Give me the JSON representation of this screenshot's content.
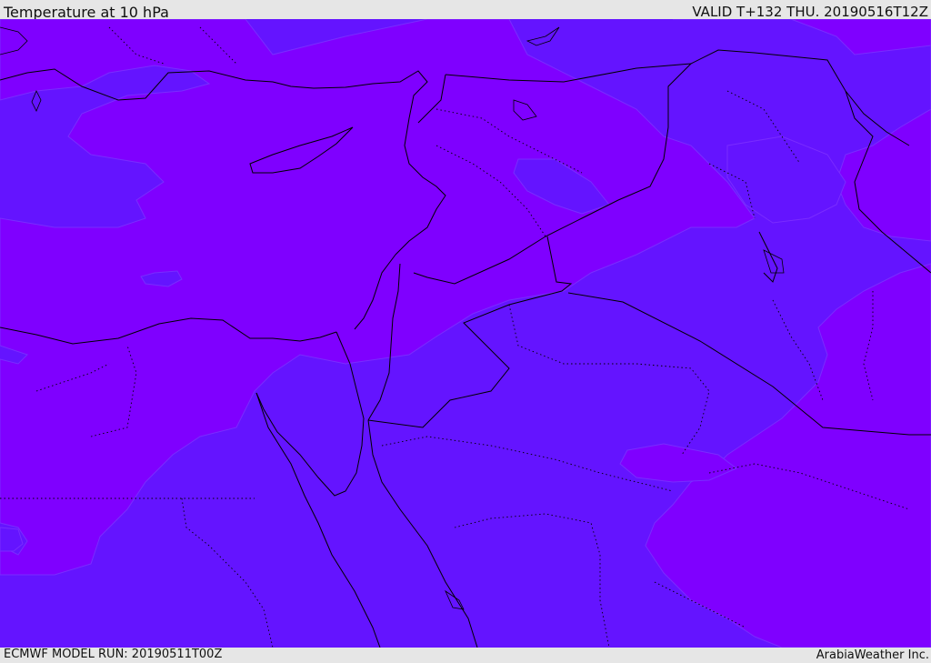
{
  "header": {
    "title": "Temperature at 10 hPa",
    "valid": "VALID T+132 THU. 20190516T12Z"
  },
  "footer": {
    "model_run": "ECMWF MODEL RUN: 20190511T00Z",
    "credit": "ArabiaWeather Inc."
  },
  "map": {
    "colors": {
      "warm_band": "#7f00ff",
      "cool_band": "#6414ff",
      "band_edge": "#7a2cff",
      "border": "#000000"
    }
  }
}
